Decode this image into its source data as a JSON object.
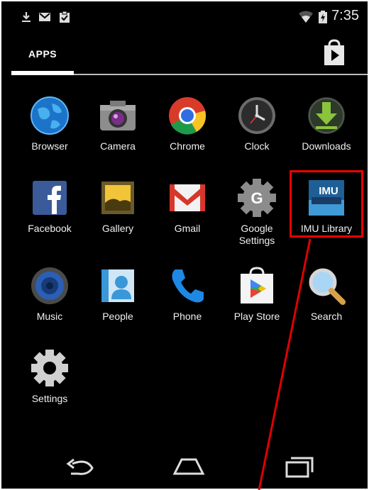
{
  "status_bar": {
    "time": "7:35",
    "left_icons": [
      "download-icon",
      "mail-icon",
      "clipboard-check-icon"
    ],
    "right_icons": [
      "wifi-icon",
      "battery-icon"
    ]
  },
  "header": {
    "tab_label": "APPS",
    "store_icon": "play-store-bag-icon"
  },
  "apps": [
    {
      "label": "Browser",
      "icon": "globe-icon"
    },
    {
      "label": "Camera",
      "icon": "camera-icon"
    },
    {
      "label": "Chrome",
      "icon": "chrome-icon"
    },
    {
      "label": "Clock",
      "icon": "clock-icon"
    },
    {
      "label": "Downloads",
      "icon": "download-arrow-icon"
    },
    {
      "label": "Facebook",
      "icon": "facebook-icon"
    },
    {
      "label": "Gallery",
      "icon": "picture-frame-icon"
    },
    {
      "label": "Gmail",
      "icon": "envelope-icon"
    },
    {
      "label": "Google\nSettings",
      "icon": "google-gear-icon"
    },
    {
      "label": "IMU Library",
      "icon": "imu-library-icon",
      "highlighted": true,
      "icon_text": "IMU"
    },
    {
      "label": "Music",
      "icon": "speaker-icon"
    },
    {
      "label": "People",
      "icon": "contacts-icon"
    },
    {
      "label": "Phone",
      "icon": "phone-handset-icon"
    },
    {
      "label": "Play Store",
      "icon": "play-store-icon"
    },
    {
      "label": "Search",
      "icon": "magnifier-icon"
    },
    {
      "label": "Settings",
      "icon": "gear-icon"
    }
  ],
  "navigation": {
    "back_icon": "back-arrow-icon",
    "home_icon": "home-icon",
    "recents_icon": "recent-apps-icon"
  },
  "colors": {
    "background": "#000000",
    "highlight": "#e00000",
    "label_text": "#f0f0f0"
  }
}
